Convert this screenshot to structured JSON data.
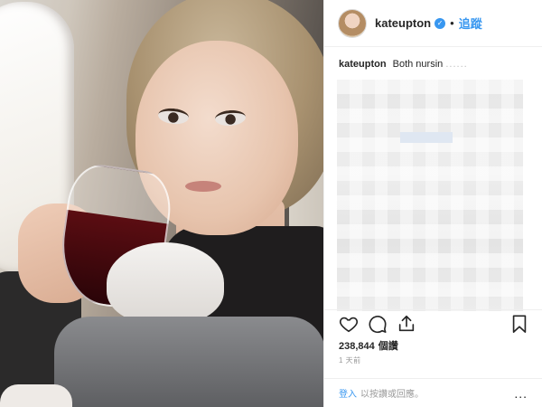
{
  "header": {
    "username": "kateupton",
    "separator": "•",
    "follow_label": "追蹤"
  },
  "caption": {
    "username": "kateupton",
    "text": "Both nursin",
    "faded": "......"
  },
  "stats": {
    "likes_count": "238,844",
    "likes_label": "個讚",
    "time_ago": "1 天前"
  },
  "footer": {
    "login_label": "登入",
    "comment_prompt": "以按讚或回應。",
    "more_label": "..."
  },
  "icons": {
    "verified": "verified-badge-icon",
    "like": "heart-icon",
    "comment": "comment-bubble-icon",
    "share": "share-icon",
    "save": "bookmark-icon"
  },
  "colors": {
    "accent": "#3897f0",
    "text": "#262626",
    "muted": "#999999",
    "border": "#efefef"
  }
}
